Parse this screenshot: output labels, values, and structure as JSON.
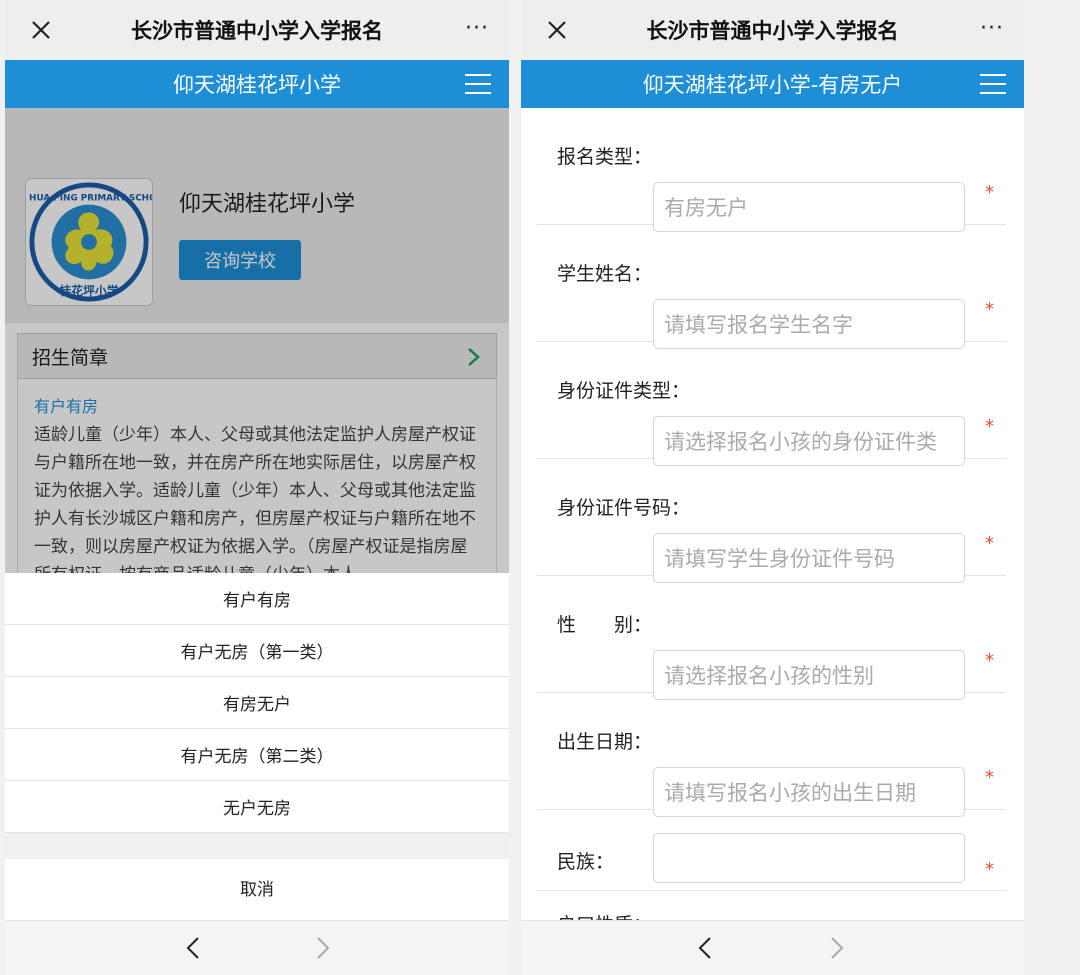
{
  "left": {
    "top_title": "长沙市普通中小学入学报名",
    "more": "···",
    "header": "仰天湖桂花坪小学",
    "school_name": "仰天湖桂花坪小学",
    "consult_button": "咨询学校",
    "logo_text": {
      "top": "GUI HUA PING PRIMARY SCHOOL",
      "bottom": "桂花坪小学"
    },
    "intro": {
      "title": "招生简章",
      "subtitle": "有户有房",
      "body": "适龄儿童（少年）本人、父母或其他法定监护人房屋产权证与户籍所在地一致，并在房产所在地实际居住，以房屋产权证为依据入学。适龄儿童（少年）本人、父母或其他法定监护人有长沙城区户籍和房产，但房屋产权证与户籍所在地不一致，则以房屋产权证为依据入学。（房屋产权证是指房屋所有权证、按有商品适龄儿童（少年）本人"
    },
    "sheet_options": [
      "有户有房",
      "有户无房（第一类）",
      "有房无户",
      "有户无房（第二类）",
      "无户无房"
    ],
    "cancel": "取消"
  },
  "right": {
    "top_title": "长沙市普通中小学入学报名",
    "more": "···",
    "header": "仰天湖桂花坪小学-有房无户",
    "fields": [
      {
        "label": "报名类型：",
        "placeholder": "有房无户",
        "required": "*"
      },
      {
        "label": "学生姓名：",
        "placeholder": "请填写报名学生名字",
        "required": "*"
      },
      {
        "label": "身份证件类型：",
        "placeholder": "请选择报名小孩的身份证件类",
        "required": "*"
      },
      {
        "label": "身份证件号码：",
        "placeholder": "请填写学生身份证件号码",
        "required": "*"
      },
      {
        "label": "性　　别：",
        "placeholder": "请选择报名小孩的性别",
        "required": "*"
      },
      {
        "label": "出生日期：",
        "placeholder": "请填写报名小孩的出生日期",
        "required": "*"
      },
      {
        "label": "民族：",
        "placeholder": "",
        "required": "*"
      }
    ],
    "partial_label": "户口性质："
  },
  "colors": {
    "accent": "#1e8fd6",
    "required": "#e8512b"
  }
}
